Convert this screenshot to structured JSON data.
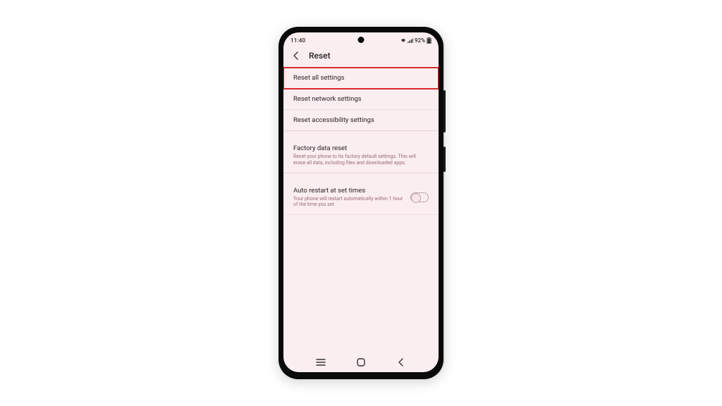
{
  "status": {
    "time": "11:40",
    "battery_text": "92%"
  },
  "header": {
    "title": "Reset"
  },
  "rows": {
    "reset_all": {
      "label": "Reset all settings"
    },
    "reset_network": {
      "label": "Reset network settings"
    },
    "reset_accessibility": {
      "label": "Reset accessibility settings"
    },
    "factory": {
      "label": "Factory data reset",
      "sub": "Reset your phone to its factory default settings. This will erase all data, including files and downloaded apps."
    },
    "auto_restart": {
      "label": "Auto restart at set times",
      "sub": "Your phone will restart automatically within 1 hour of the time you set.",
      "enabled": false
    }
  }
}
